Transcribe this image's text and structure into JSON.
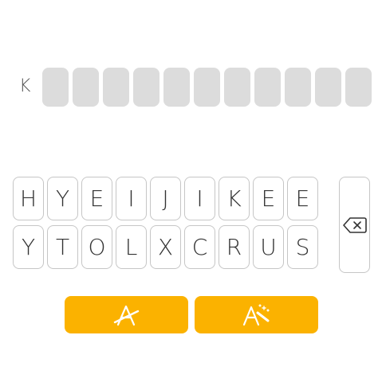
{
  "clue": {
    "letter": "K"
  },
  "answer": {
    "slot_count": 11
  },
  "keyboard": {
    "rows": [
      [
        "H",
        "Y",
        "E",
        "I",
        "J",
        "I",
        "K",
        "E",
        "E"
      ],
      [
        "Y",
        "T",
        "O",
        "L",
        "X",
        "C",
        "R",
        "U",
        "S"
      ]
    ],
    "backspace_icon": "backspace-icon"
  },
  "actions": [
    {
      "icon": "clear-letters-icon"
    },
    {
      "icon": "hint-magic-icon"
    }
  ],
  "colors": {
    "accent": "#fbb200",
    "slot": "#dcdcdc",
    "key_border": "#c6c6c6",
    "text": "#333333"
  }
}
